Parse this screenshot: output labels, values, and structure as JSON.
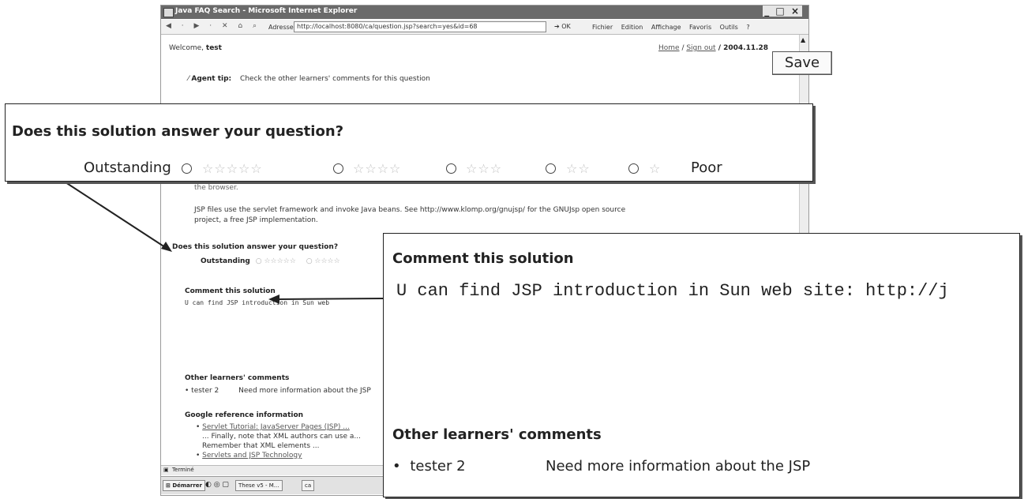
{
  "window": {
    "title": "Java FAQ Search - Microsoft Internet Explorer",
    "controls": "_ □ ×"
  },
  "toolbar": {
    "nav": "◀ · ▶ · ✕ ⌂ ⌕",
    "address_label": "Adresse",
    "address": "http://localhost:8080/ca/question.jsp?search=yes&id=68",
    "go_label": "OK",
    "menus": "Fichier Edition Affichage Favoris Outils ?"
  },
  "page": {
    "welcome_prefix": "Welcome, ",
    "username": "test",
    "top_links": {
      "home": "Home",
      "sep": " / ",
      "signout": "Sign out",
      "date": " / 2004.11.28"
    },
    "agent_tip_label": "Agent tip:",
    "agent_tip_text": "Check the other learners' comments for this question",
    "answer_end": "the browser.",
    "answer_para": "JSP files use the servlet framework and invoke Java beans. See http://www.klomp.org/gnujsp/ for the GNUJsp open source project, a free JSP implementation.",
    "rating_question": "Does this solution answer your question?",
    "rating_outstanding": "Outstanding",
    "rating_small_1": "○ ☆☆☆☆☆",
    "rating_small_2": "○ ☆☆☆☆",
    "comment_heading": "Comment this solution",
    "comment_text": "U can find JSP introduction in Sun web",
    "other_heading": "Other learners' comments",
    "other_user": "tester 2",
    "other_text": "Need more information about the JSP",
    "google_heading": "Google reference information",
    "google_link1": "Servlet Tutorial: JavaServer Pages (JSP) ...",
    "google_snip1": "... Finally, note that XML authors can use a...",
    "google_snip2": "Remember that XML elements ...",
    "google_link2": "Servlets and JSP Technology"
  },
  "status": {
    "text": "Terminé"
  },
  "taskbar": {
    "start": "Démarrer",
    "task1": "These v5 - M...",
    "task2": "ca"
  },
  "callout_rating": {
    "question": "Does this solution answer your question?",
    "left_label": "Outstanding",
    "right_label": "Poor",
    "star_levels": [
      5,
      4,
      3,
      2,
      1
    ],
    "save_label": "Save"
  },
  "callout_comment": {
    "heading": "Comment this solution",
    "comment_text": "U can find JSP introduction in Sun web site: http://j",
    "other_heading": "Other learners' comments",
    "other_user": "tester 2",
    "other_text": "Need more information about the JSP"
  }
}
